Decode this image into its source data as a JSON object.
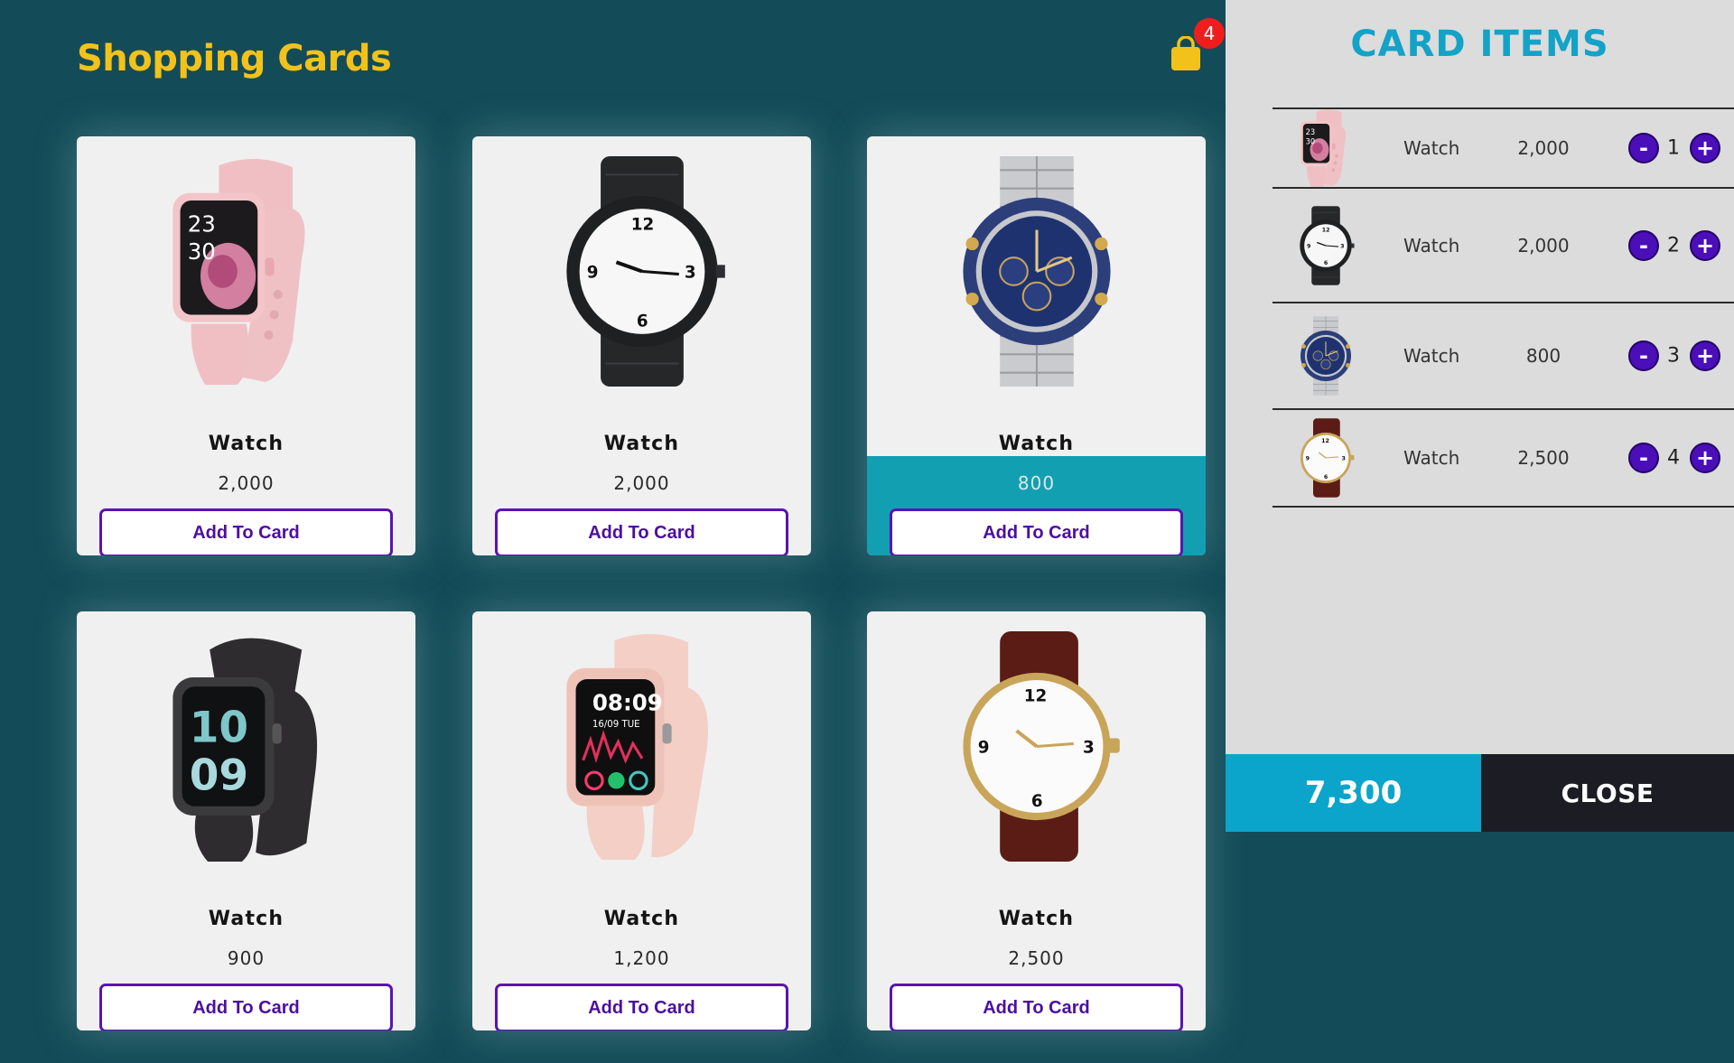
{
  "header": {
    "title": "Shopping Cards",
    "cart_count": "4",
    "cart_icon": "shopping-bag-icon"
  },
  "colors": {
    "background": "#134c58",
    "title": "#f2c21b",
    "accent": "#4b0fa0",
    "highlight": "#129fb1",
    "badge": "#f01d1d",
    "panel_title": "#14a2c7",
    "total_bg": "#0ba5cb",
    "close_bg": "#1c1d24"
  },
  "products": [
    {
      "name": "Watch",
      "price": "2,000",
      "button": "Add To Card",
      "image": "pink-smartwatch"
    },
    {
      "name": "Watch",
      "price": "2,000",
      "button": "Add To Card",
      "image": "black-analog-watch"
    },
    {
      "name": "Watch",
      "price": "800",
      "button": "Add To Card",
      "image": "blue-chronograph-watch"
    },
    {
      "name": "Watch",
      "price": "900",
      "button": "Add To Card",
      "image": "black-smartwatch"
    },
    {
      "name": "Watch",
      "price": "1,200",
      "button": "Add To Card",
      "image": "peach-smartwatch"
    },
    {
      "name": "Watch",
      "price": "2,500",
      "button": "Add To Card",
      "image": "brown-leather-watch"
    }
  ],
  "cart": {
    "title": "CARD ITEMS",
    "items": [
      {
        "name": "Watch",
        "price": "2,000",
        "qty": "1",
        "minus": "-",
        "plus": "+"
      },
      {
        "name": "Watch",
        "price": "2,000",
        "qty": "2",
        "minus": "-",
        "plus": "+"
      },
      {
        "name": "Watch",
        "price": "800",
        "qty": "3",
        "minus": "-",
        "plus": "+"
      },
      {
        "name": "Watch",
        "price": "2,500",
        "qty": "4",
        "minus": "-",
        "plus": "+"
      }
    ],
    "total": "7,300",
    "close_label": "CLOSE"
  }
}
